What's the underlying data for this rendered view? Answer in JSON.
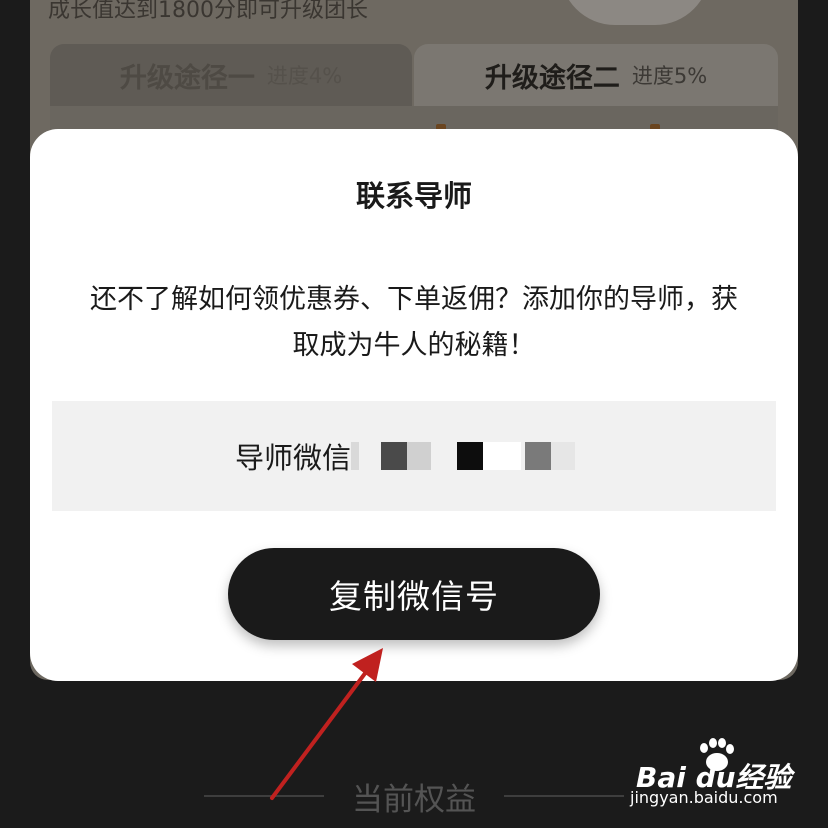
{
  "background": {
    "progress_text": "成长值达到1800分即可升级团长",
    "tabs": [
      {
        "name": "升级途径一",
        "progress": "进度4%"
      },
      {
        "name": "升级途径二",
        "progress": "进度5%"
      }
    ],
    "section_title": "当前权益"
  },
  "modal": {
    "title": "联系导师",
    "message_line1": "还不了解如何领优惠券、下单返佣？添加你的导师，获",
    "message_line2": "取成为牛人的秘籍！",
    "wechat_label": "导师微信",
    "wechat_id_redacted": true,
    "copy_button_label": "复制微信号"
  },
  "watermark": {
    "logo_text": "Bai du经验",
    "url": "jingyan.baidu.com"
  },
  "colors": {
    "modal_bg": "#ffffff",
    "button_bg": "#1a1a1a",
    "button_text": "#ffffff",
    "arrow": "#c0211f",
    "wechat_box_bg": "#f1f1f1"
  }
}
